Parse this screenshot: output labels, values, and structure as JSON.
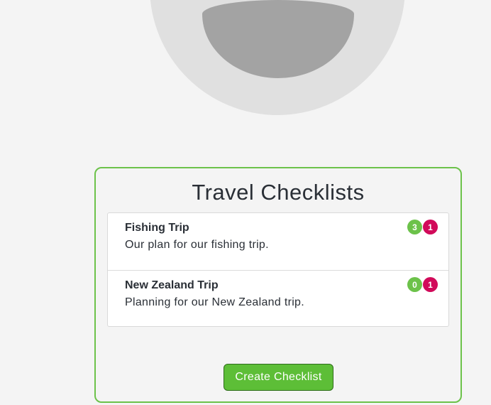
{
  "colors": {
    "accent_green": "#6cc24a",
    "badge_red": "#d10a5a",
    "button_green": "#5dbe37",
    "avatar_bg": "#e0e0e0",
    "avatar_fg": "#a3a3a3"
  },
  "avatar": {
    "icon": "user-avatar-icon"
  },
  "card": {
    "title": "Travel Checklists",
    "items": [
      {
        "name": "Fishing Trip",
        "description": "Our plan for our fishing trip.",
        "count_green": "3",
        "count_red": "1"
      },
      {
        "name": "New Zealand Trip",
        "description": "Planning for our New Zealand trip.",
        "count_green": "0",
        "count_red": "1"
      }
    ],
    "create_button_label": "Create Checklist"
  }
}
